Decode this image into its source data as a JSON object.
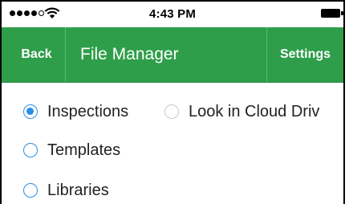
{
  "status_bar": {
    "time": "4:43 PM",
    "signal_icon": "signal-dots-icon",
    "wifi_icon": "wifi-icon",
    "battery_icon": "battery-icon"
  },
  "nav_bar": {
    "back_label": "Back",
    "title": "File Manager",
    "settings_label": "Settings",
    "color": "#2e9e4a"
  },
  "options": {
    "inspections_label": "Inspections",
    "cloud_label": "Look in Cloud Driv",
    "templates_label": "Templates",
    "libraries_label": "Libraries",
    "selected": "Inspections",
    "accent_color": "#2a8ee6"
  }
}
